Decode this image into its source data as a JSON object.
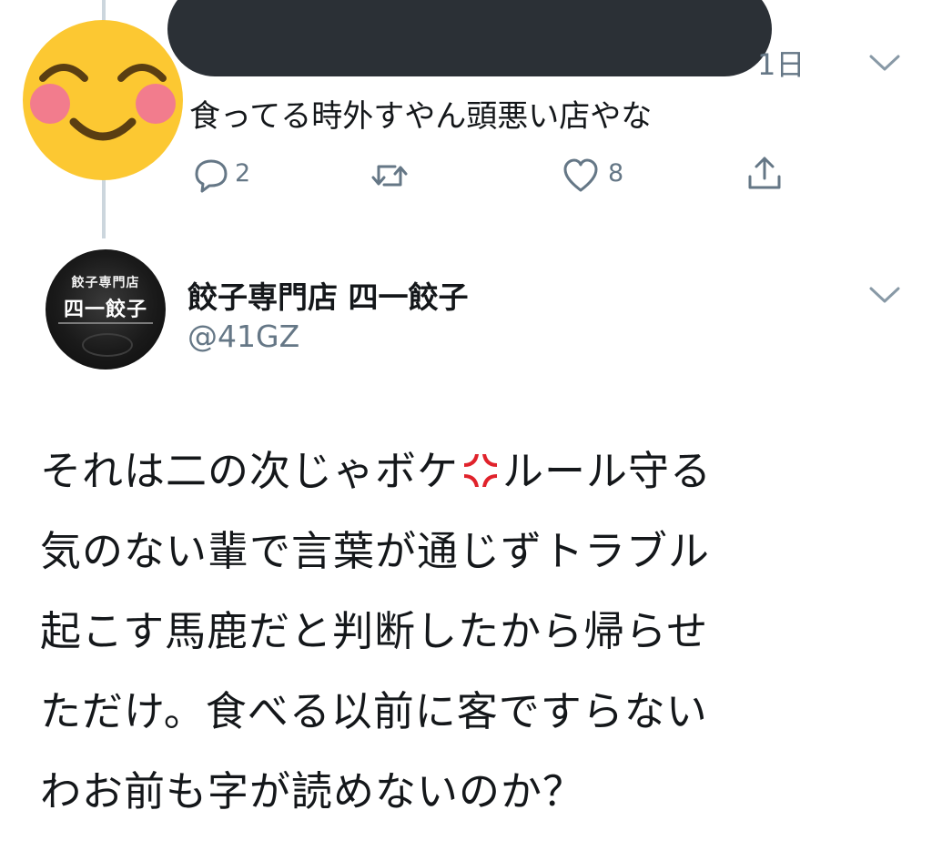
{
  "reply_tweet": {
    "time": "1日",
    "text": "食ってる時外すやん頭悪い店やな",
    "reply_count": "2",
    "like_count": "8"
  },
  "main_tweet": {
    "author": {
      "display_name": "餃子専門店 四一餃子",
      "handle": "@41GZ",
      "avatar_text_small": "餃子専門店",
      "avatar_text_large": "四一餃子"
    },
    "body_lines": [
      {
        "before": "それは二の次じゃボケ",
        "after": "ルール守る"
      },
      "気のない輩で言葉が通じずトラブル",
      "起こす馬鹿だと判断したから帰らせ",
      "ただけ。食べる以前に客ですらない",
      "わお前も字が読めないのか？"
    ]
  },
  "icons": {
    "reply_avatar": "smiling-emoji-face",
    "redaction": "blacked-out-name",
    "chevron": "chevron-down-icon",
    "comment": "comment-icon",
    "retweet": "retweet-icon",
    "like": "heart-icon",
    "share": "share-icon",
    "inline_emoji": "anger-symbol-emoji"
  },
  "colors": {
    "text": "#14171a",
    "secondary_text": "#657786",
    "thread_line": "#ccd6dd",
    "redaction": "#2b3036",
    "emoji_face": "#fcc832",
    "anger": "#e0222b"
  }
}
